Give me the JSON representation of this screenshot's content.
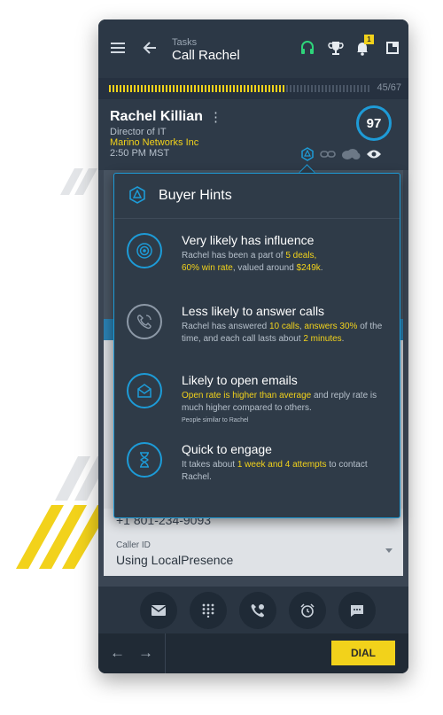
{
  "colors": {
    "accent": "#1d9bd7",
    "highlight": "#f2d21b",
    "background": "#2a3542"
  },
  "header": {
    "breadcrumb": "Tasks",
    "title": "Call Rachel",
    "icons": [
      "menu-icon",
      "back-arrow-icon",
      "headset-icon",
      "trophy-icon",
      "bell-icon",
      "window-icon"
    ],
    "notification_count": "1"
  },
  "progress": {
    "label": "45/67",
    "fraction": 0.67
  },
  "contact": {
    "name": "Rachel Killian",
    "title": "Director of IT",
    "company": "Marino Networks Inc",
    "time": "2:50 PM MST",
    "score": "97"
  },
  "buyer_hints": {
    "title": "Buyer Hints",
    "items": [
      {
        "heading": "Very likely has influence",
        "parts": [
          {
            "t": "Rachel has been a part of ",
            "h": false
          },
          {
            "t": "5 deals,",
            "h": true
          },
          {
            "t": "\n",
            "h": false
          },
          {
            "t": "60% win rate",
            "h": true
          },
          {
            "t": ", valued around ",
            "h": false
          },
          {
            "t": "$249k",
            "h": true
          },
          {
            "t": ".",
            "h": false
          }
        ]
      },
      {
        "heading": "Less likely to answer calls",
        "parts": [
          {
            "t": "Rachel has answered ",
            "h": false
          },
          {
            "t": "10 calls",
            "h": true
          },
          {
            "t": ", ",
            "h": false
          },
          {
            "t": "answers 30%",
            "h": true
          },
          {
            "t": " of the time, and each call lasts about ",
            "h": false
          },
          {
            "t": "2 minutes",
            "h": true
          },
          {
            "t": ".",
            "h": false
          }
        ]
      },
      {
        "heading": "Likely to open emails",
        "parts": [
          {
            "t": "Open rate is higher than average",
            "h": true
          },
          {
            "t": " and reply rate is much higher compared to others.",
            "h": false
          }
        ],
        "note": "People similar to Rachel"
      },
      {
        "heading": "Quick to engage",
        "parts": [
          {
            "t": "It takes about ",
            "h": false
          },
          {
            "t": "1 week and 4 attempts",
            "h": true
          },
          {
            "t": " to contact Rachel.",
            "h": false
          }
        ]
      }
    ]
  },
  "phone_field": {
    "value": "+1 801-234-9093"
  },
  "caller_id": {
    "label": "Caller ID",
    "value": "Using LocalPresence"
  },
  "actions": [
    "email-icon",
    "dialpad-icon",
    "voicemail-icon",
    "alarm-icon",
    "message-icon"
  ],
  "footer": {
    "dial_label": "DIAL"
  }
}
